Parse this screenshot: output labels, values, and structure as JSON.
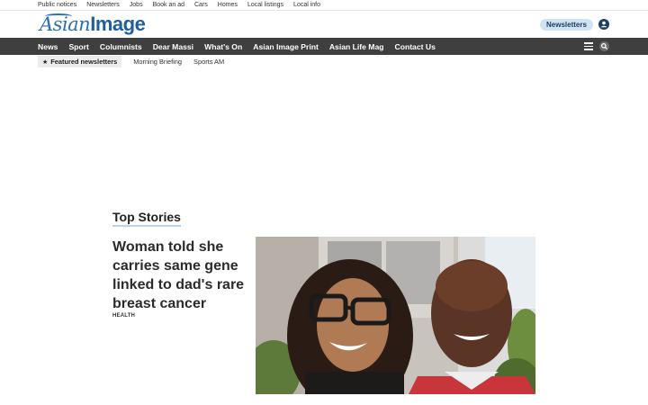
{
  "utility_bar": {
    "links": [
      "Public notices",
      "Newsletters",
      "Jobs",
      "Book an ad",
      "Cars",
      "Homes",
      "Local listings",
      "Local info"
    ]
  },
  "masthead": {
    "logo_part1": "Asian",
    "logo_part2": "Image",
    "newsletters_button": "Newsletters",
    "account_icon": "user-icon",
    "brand_color": "#1f5f9e"
  },
  "main_nav": {
    "items": [
      "News",
      "Sport",
      "Columnists",
      "Dear Massi",
      "What's On",
      "Asian Image Print",
      "Asian Life Mag",
      "Contact Us"
    ],
    "menu_icon": "hamburger-icon",
    "search_icon": "search-icon",
    "background_color": "#3f3f3f"
  },
  "subnav": {
    "featured_label": "Featured newsletters",
    "featured_icon": "star-icon",
    "items": [
      "Morning Briefing",
      "Sports AM"
    ]
  },
  "top_stories": {
    "title": "Top Stories",
    "lead": {
      "headline": "Woman told she carries same gene linked to dad's rare breast cancer",
      "tag": "HEALTH"
    }
  }
}
